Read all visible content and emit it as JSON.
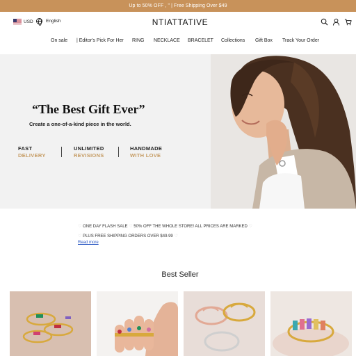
{
  "announcement": {
    "text": "Up to 50% OFF , \" | Free Shipping Over $49"
  },
  "header": {
    "currency": "USD",
    "language": "English",
    "logo": "NTIATTATIVE",
    "icons": [
      "search-icon",
      "user-icon",
      "cart-icon"
    ]
  },
  "nav": {
    "items": [
      {
        "label": "On sale"
      },
      {
        "label": "| Editor's Pick For Her"
      },
      {
        "label": "RING"
      },
      {
        "label": "NECKLACE"
      },
      {
        "label": "BRACELET"
      },
      {
        "label": "Collections"
      },
      {
        "label": "Gift Box"
      },
      {
        "label": "Track Your Order"
      }
    ]
  },
  "hero": {
    "title": "“The Best Gift Ever”",
    "subtitle": "Create a one-of-a-kind piece in the world.",
    "features": [
      {
        "line1": "FAST",
        "line2": "DELIVERY"
      },
      {
        "line1": "UNLIMITED",
        "line2": "REVISIONS"
      },
      {
        "line1": "HANDMADE",
        "line2": "WITH LOVE"
      }
    ]
  },
  "promo": {
    "line1": "ONE DAY FLASH SALE",
    "line1b": "50% OFF THE WHOLE STORE! ALL PRICES ARE MARKED",
    "line2": "PLUS FREE SHIPPING ORDERS OVER $49.99",
    "read_more": "Read more"
  },
  "best_seller": {
    "title": "Best Seller",
    "products": [
      {
        "image": "birthstone-rings-stack"
      },
      {
        "image": "hand-with-rings"
      },
      {
        "image": "name-rings-gold-silver"
      },
      {
        "image": "gold-ring-colored-stones"
      }
    ]
  },
  "colors": {
    "announcement_bg": "#c8925a",
    "accent_gold": "#c59b62",
    "link_blue": "#2a57c2"
  }
}
